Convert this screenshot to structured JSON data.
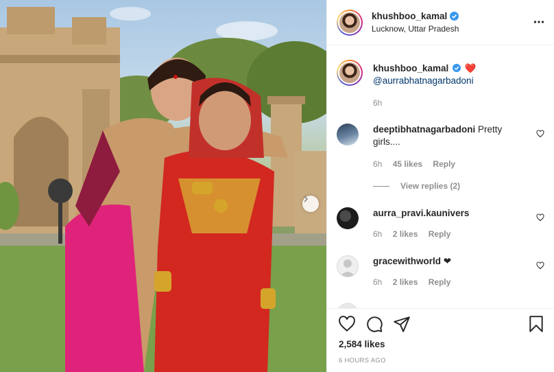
{
  "post": {
    "image_alt": "Two women in traditional red and pink saris posing outdoors",
    "carousel_next_icon": "chevron-right-icon"
  },
  "header": {
    "username": "khushboo_kamal",
    "location": "Lucknow, Uttar Pradesh",
    "verified_icon": "verified-badge-icon",
    "more_icon": "more-horizontal-icon"
  },
  "caption": {
    "username": "khushboo_kamal",
    "text": "❤️️️",
    "mention": "@aurrabhatnagarbadoni",
    "time": "6h"
  },
  "comments": [
    {
      "username": "deeptibhatnagarbadoni",
      "text": "Pretty girls....",
      "time": "6h",
      "likes": "45 likes",
      "reply": "Reply",
      "view_replies": "View replies (2)"
    },
    {
      "username": "aurra_pravi.kaunivers",
      "text": "",
      "time": "6h",
      "likes": "2 likes",
      "reply": "Reply"
    },
    {
      "username": "gracewithworld",
      "text": "❤",
      "time": "6h",
      "likes": "2 likes",
      "reply": "Reply"
    }
  ],
  "actions": {
    "like_icon": "heart-icon",
    "comment_icon": "comment-icon",
    "share_icon": "paper-plane-icon",
    "save_icon": "bookmark-icon",
    "likes_count": "2,584 likes",
    "time_ago": "6 HOURS AGO"
  },
  "colors": {
    "text": "#262626",
    "secondary": "#8e8e8e",
    "verified": "#3897f0",
    "mention": "#00376b",
    "border": "#efefef"
  }
}
